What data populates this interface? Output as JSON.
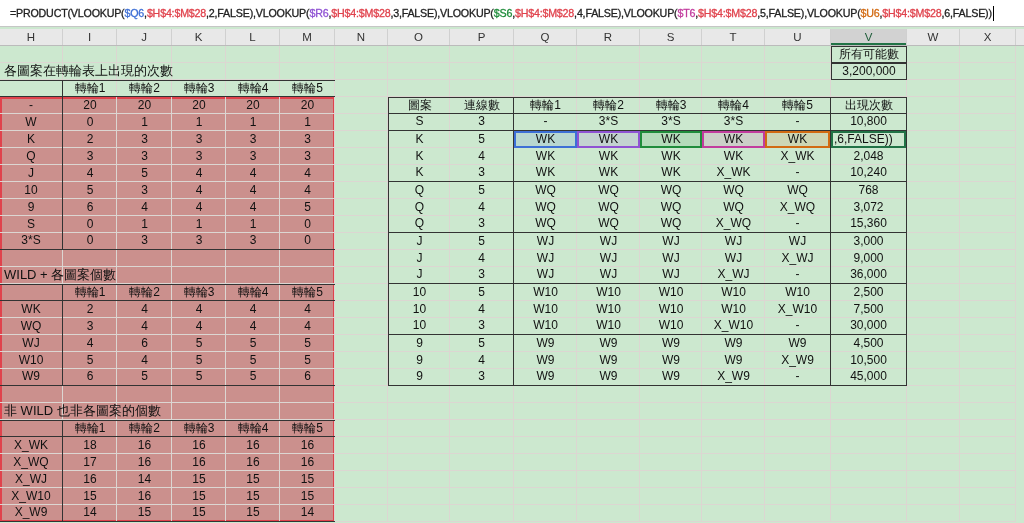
{
  "formula_bar": {
    "parts": [
      {
        "kind": "text",
        "text": "=PRODUCT(VLOOKUP("
      },
      {
        "kind": "cell_ref",
        "text": "$Q6",
        "color": "#3d6fd6"
      },
      {
        "kind": "text",
        "text": ","
      },
      {
        "kind": "range_ref",
        "text": "$H$4:$M$28",
        "color": "#e0424c"
      },
      {
        "kind": "text",
        "text": ",2,FALSE),VLOOKUP("
      },
      {
        "kind": "cell_ref",
        "text": "$R6",
        "color": "#8f52d3"
      },
      {
        "kind": "text",
        "text": ","
      },
      {
        "kind": "range_ref",
        "text": "$H$4:$M$28",
        "color": "#e0424c"
      },
      {
        "kind": "text",
        "text": ",3,FALSE),VLOOKUP("
      },
      {
        "kind": "cell_ref",
        "text": "$S6",
        "color": "#1f8c3b"
      },
      {
        "kind": "text",
        "text": ","
      },
      {
        "kind": "range_ref",
        "text": "$H$4:$M$28",
        "color": "#e0424c"
      },
      {
        "kind": "text",
        "text": ",4,FALSE),VLOOKUP("
      },
      {
        "kind": "cell_ref",
        "text": "$T6",
        "color": "#c23c9e"
      },
      {
        "kind": "text",
        "text": ","
      },
      {
        "kind": "range_ref",
        "text": "$H$4:$M$28",
        "color": "#e0424c"
      },
      {
        "kind": "text",
        "text": ",5,FALSE),VLOOKUP("
      },
      {
        "kind": "cell_ref",
        "text": "$U6",
        "color": "#d26a12"
      },
      {
        "kind": "text",
        "text": ","
      },
      {
        "kind": "range_ref",
        "text": "$H$4:$M$28",
        "color": "#e0424c"
      },
      {
        "kind": "text",
        "text": ",6,FALSE))"
      }
    ]
  },
  "columns": [
    {
      "label": "H",
      "selected": false
    },
    {
      "label": "I",
      "selected": false
    },
    {
      "label": "J",
      "selected": false
    },
    {
      "label": "K",
      "selected": false
    },
    {
      "label": "L",
      "selected": false
    },
    {
      "label": "M",
      "selected": false
    },
    {
      "label": "N",
      "selected": false
    },
    {
      "label": "O",
      "selected": false
    },
    {
      "label": "P",
      "selected": false
    },
    {
      "label": "Q",
      "selected": false
    },
    {
      "label": "R",
      "selected": false
    },
    {
      "label": "S",
      "selected": false
    },
    {
      "label": "T",
      "selected": false
    },
    {
      "label": "U",
      "selected": false
    },
    {
      "label": "V",
      "selected": true
    },
    {
      "label": "W",
      "selected": false
    },
    {
      "label": "X",
      "selected": false
    }
  ],
  "total": {
    "label": "所有可能數",
    "value": "3,200,000"
  },
  "left_tables": {
    "highlighted": true,
    "tables": [
      {
        "title": "各圖案在轉輪表上出現的次數",
        "columns": [
          "轉輪1",
          "轉輪2",
          "轉輪3",
          "轉輪4",
          "轉輪5"
        ],
        "rows": [
          {
            "label": "-",
            "values": [
              "20",
              "20",
              "20",
              "20",
              "20"
            ]
          },
          {
            "label": "W",
            "values": [
              "0",
              "1",
              "1",
              "1",
              "1"
            ]
          },
          {
            "label": "K",
            "values": [
              "2",
              "3",
              "3",
              "3",
              "3"
            ]
          },
          {
            "label": "Q",
            "values": [
              "3",
              "3",
              "3",
              "3",
              "3"
            ]
          },
          {
            "label": "J",
            "values": [
              "4",
              "5",
              "4",
              "4",
              "4"
            ]
          },
          {
            "label": "10",
            "values": [
              "5",
              "3",
              "4",
              "4",
              "4"
            ]
          },
          {
            "label": "9",
            "values": [
              "6",
              "4",
              "4",
              "4",
              "5"
            ]
          },
          {
            "label": "S",
            "values": [
              "0",
              "1",
              "1",
              "1",
              "0"
            ]
          },
          {
            "label": "3*S",
            "values": [
              "0",
              "3",
              "3",
              "3",
              "0"
            ]
          }
        ]
      },
      {
        "title": "WILD + 各圖案個數",
        "columns": [
          "轉輪1",
          "轉輪2",
          "轉輪3",
          "轉輪4",
          "轉輪5"
        ],
        "rows": [
          {
            "label": "WK",
            "values": [
              "2",
              "4",
              "4",
              "4",
              "4"
            ]
          },
          {
            "label": "WQ",
            "values": [
              "3",
              "4",
              "4",
              "4",
              "4"
            ]
          },
          {
            "label": "WJ",
            "values": [
              "4",
              "6",
              "5",
              "5",
              "5"
            ]
          },
          {
            "label": "W10",
            "values": [
              "5",
              "4",
              "5",
              "5",
              "5"
            ]
          },
          {
            "label": "W9",
            "values": [
              "6",
              "5",
              "5",
              "5",
              "6"
            ]
          }
        ]
      },
      {
        "title": "非 WILD 也非各圖案的個數",
        "columns": [
          "轉輪1",
          "轉輪2",
          "轉輪3",
          "轉輪4",
          "轉輪5"
        ],
        "rows": [
          {
            "label": "X_WK",
            "values": [
              "18",
              "16",
              "16",
              "16",
              "16"
            ]
          },
          {
            "label": "X_WQ",
            "values": [
              "17",
              "16",
              "16",
              "16",
              "16"
            ]
          },
          {
            "label": "X_WJ",
            "values": [
              "16",
              "14",
              "15",
              "15",
              "15"
            ]
          },
          {
            "label": "X_W10",
            "values": [
              "15",
              "16",
              "15",
              "15",
              "15"
            ]
          },
          {
            "label": "X_W9",
            "values": [
              "14",
              "15",
              "15",
              "15",
              "14"
            ]
          }
        ]
      }
    ]
  },
  "right_table": {
    "columns": [
      "圖案",
      "連線數",
      "轉輪1",
      "轉輪2",
      "轉輪3",
      "轉輪4",
      "轉輪5",
      "出現次數"
    ],
    "groups": [
      {
        "rows": [
          {
            "symbol": "S",
            "count": "3",
            "reels": [
              "-",
              "3*S",
              "3*S",
              "3*S",
              "-"
            ],
            "occurrences": "10,800",
            "editing": false
          }
        ]
      },
      {
        "rows": [
          {
            "symbol": "K",
            "count": "5",
            "reels": [
              "WK",
              "WK",
              "WK",
              "WK",
              "WK"
            ],
            "occurrences": ",6,FALSE))",
            "editing": true
          },
          {
            "symbol": "K",
            "count": "4",
            "reels": [
              "WK",
              "WK",
              "WK",
              "WK",
              "X_WK"
            ],
            "occurrences": "2,048",
            "editing": false
          },
          {
            "symbol": "K",
            "count": "3",
            "reels": [
              "WK",
              "WK",
              "WK",
              "X_WK",
              "-"
            ],
            "occurrences": "10,240",
            "editing": false
          }
        ]
      },
      {
        "rows": [
          {
            "symbol": "Q",
            "count": "5",
            "reels": [
              "WQ",
              "WQ",
              "WQ",
              "WQ",
              "WQ"
            ],
            "occurrences": "768",
            "editing": false
          },
          {
            "symbol": "Q",
            "count": "4",
            "reels": [
              "WQ",
              "WQ",
              "WQ",
              "WQ",
              "X_WQ"
            ],
            "occurrences": "3,072",
            "editing": false
          },
          {
            "symbol": "Q",
            "count": "3",
            "reels": [
              "WQ",
              "WQ",
              "WQ",
              "X_WQ",
              "-"
            ],
            "occurrences": "15,360",
            "editing": false
          }
        ]
      },
      {
        "rows": [
          {
            "symbol": "J",
            "count": "5",
            "reels": [
              "WJ",
              "WJ",
              "WJ",
              "WJ",
              "WJ"
            ],
            "occurrences": "3,000",
            "editing": false
          },
          {
            "symbol": "J",
            "count": "4",
            "reels": [
              "WJ",
              "WJ",
              "WJ",
              "WJ",
              "X_WJ"
            ],
            "occurrences": "9,000",
            "editing": false
          },
          {
            "symbol": "J",
            "count": "3",
            "reels": [
              "WJ",
              "WJ",
              "WJ",
              "X_WJ",
              "-"
            ],
            "occurrences": "36,000",
            "editing": false
          }
        ]
      },
      {
        "rows": [
          {
            "symbol": "10",
            "count": "5",
            "reels": [
              "W10",
              "W10",
              "W10",
              "W10",
              "W10"
            ],
            "occurrences": "2,500",
            "editing": false
          },
          {
            "symbol": "10",
            "count": "4",
            "reels": [
              "W10",
              "W10",
              "W10",
              "W10",
              "X_W10"
            ],
            "occurrences": "7,500",
            "editing": false
          },
          {
            "symbol": "10",
            "count": "3",
            "reels": [
              "W10",
              "W10",
              "W10",
              "X_W10",
              "-"
            ],
            "occurrences": "30,000",
            "editing": false
          }
        ]
      },
      {
        "rows": [
          {
            "symbol": "9",
            "count": "5",
            "reels": [
              "W9",
              "W9",
              "W9",
              "W9",
              "W9"
            ],
            "occurrences": "4,500",
            "editing": false
          },
          {
            "symbol": "9",
            "count": "4",
            "reels": [
              "W9",
              "W9",
              "W9",
              "W9",
              "X_W9"
            ],
            "occurrences": "10,500",
            "editing": false
          },
          {
            "symbol": "9",
            "count": "3",
            "reels": [
              "W9",
              "W9",
              "W9",
              "X_W9",
              "-"
            ],
            "occurrences": "45,000",
            "editing": false
          }
        ]
      }
    ]
  }
}
